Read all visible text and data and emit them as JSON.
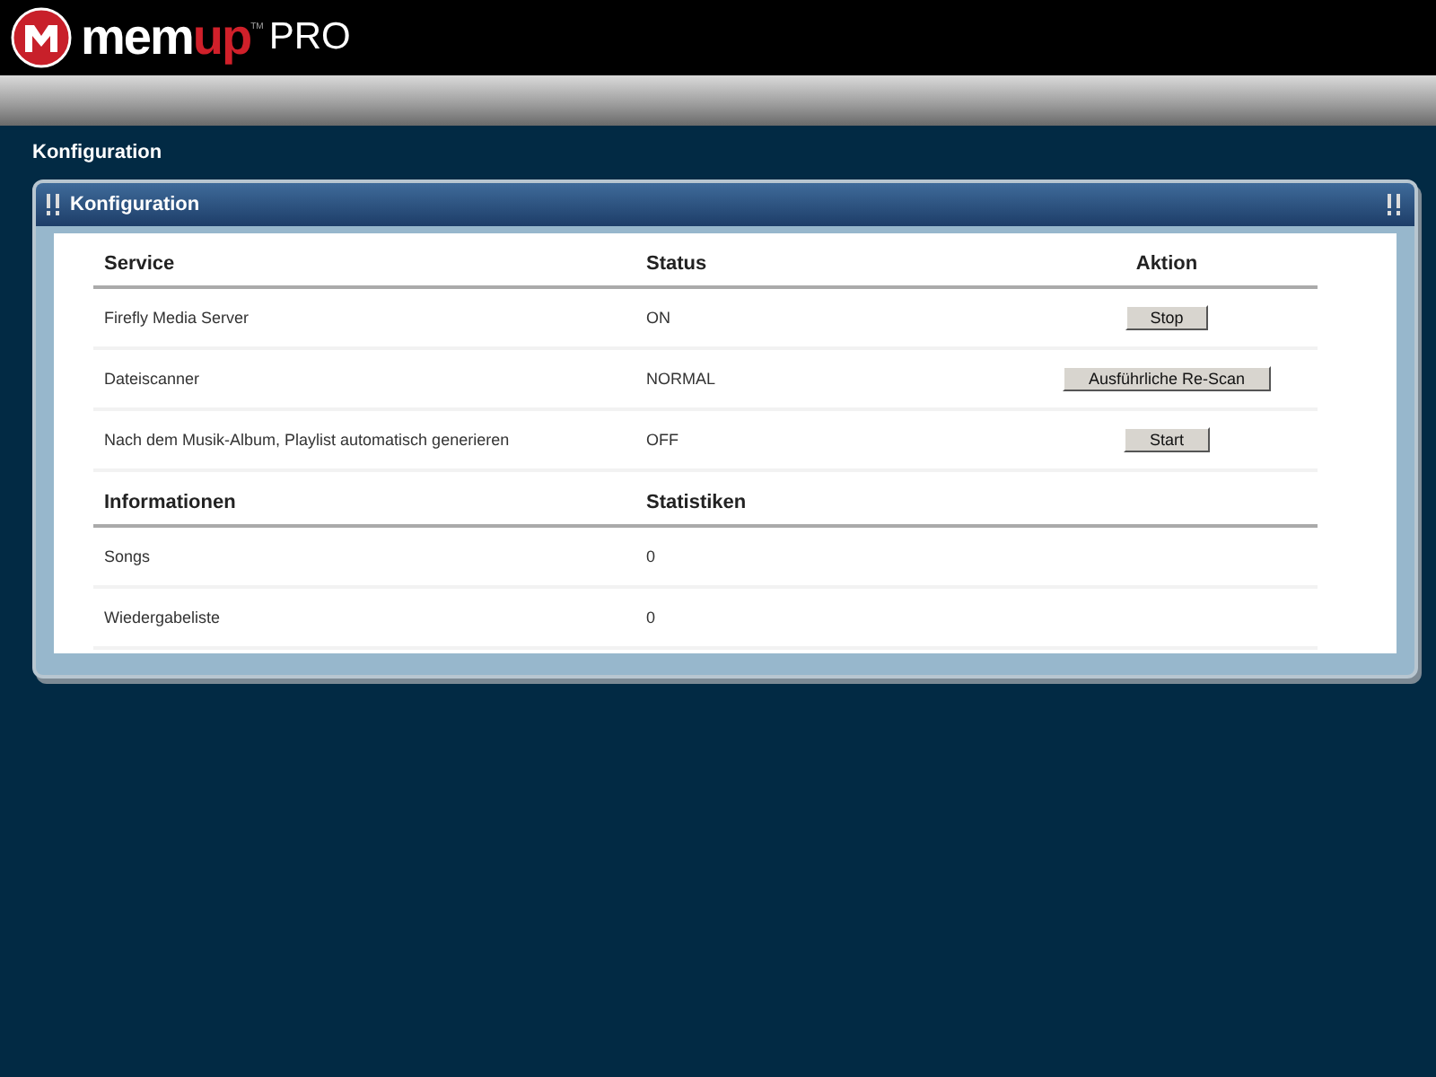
{
  "logo": {
    "brand_main": "mem",
    "brand_accent": "up",
    "trademark": "TM",
    "edition": "PRO"
  },
  "page_title": "Konfiguration",
  "panel": {
    "title": "Konfiguration",
    "services": {
      "columns": [
        "Service",
        "Status",
        "Aktion"
      ],
      "rows": [
        {
          "service": "Firefly Media Server",
          "status": "ON",
          "action": "Stop"
        },
        {
          "service": "Dateiscanner",
          "status": "NORMAL",
          "action": "Ausführliche Re-Scan"
        },
        {
          "service": "Nach dem Musik-Album, Playlist automatisch generieren",
          "status": "OFF",
          "action": "Start"
        }
      ]
    },
    "info": {
      "columns": [
        "Informationen",
        "Statistiken"
      ],
      "rows": [
        {
          "label": "Songs",
          "value": "0"
        },
        {
          "label": "Wiedergabeliste",
          "value": "0"
        }
      ]
    }
  }
}
